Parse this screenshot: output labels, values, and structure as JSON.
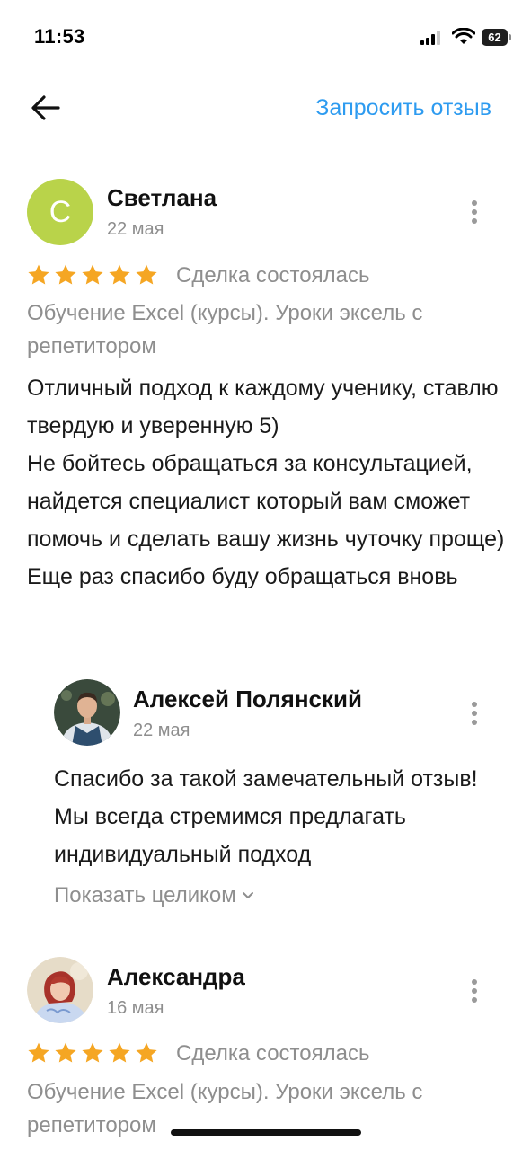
{
  "status_bar": {
    "time": "11:53",
    "battery": "62"
  },
  "header": {
    "back_icon": "arrow-left-icon",
    "request_review_label": "Запросить отзыв",
    "accent_color": "#2d9bf0"
  },
  "reviews": [
    {
      "avatar_letter": "С",
      "avatar_color": "#b9d34a",
      "author": "Светлана",
      "date": "22 мая",
      "rating": 5,
      "deal_status": "Сделка состоялась",
      "service": "Обучение Excel (курсы). Уроки эксель с репетитором",
      "text": "Отличный подход к каждому ученику, ставлю твердую и уверенную 5)\nНе бойтесь обращаться за консультацией, найдется специалист который вам сможет помочь и сделать вашу жизнь чуточку проще)\nЕще раз спасибо буду обращаться вновь",
      "reply": {
        "author": "Алексей Полянский",
        "date": "22 мая",
        "text": "Спасибо за такой замечательный отзыв! Мы всегда стремимся предлагать индивидуальный подход",
        "show_more_label": "Показать целиком"
      }
    },
    {
      "author": "Александра",
      "date": "16 мая",
      "rating": 5,
      "deal_status": "Сделка состоялась",
      "service": "Обучение Excel (курсы). Уроки эксель с репетитором"
    }
  ],
  "colors": {
    "star": "#f5a623",
    "muted_text": "#8e8e8e"
  }
}
